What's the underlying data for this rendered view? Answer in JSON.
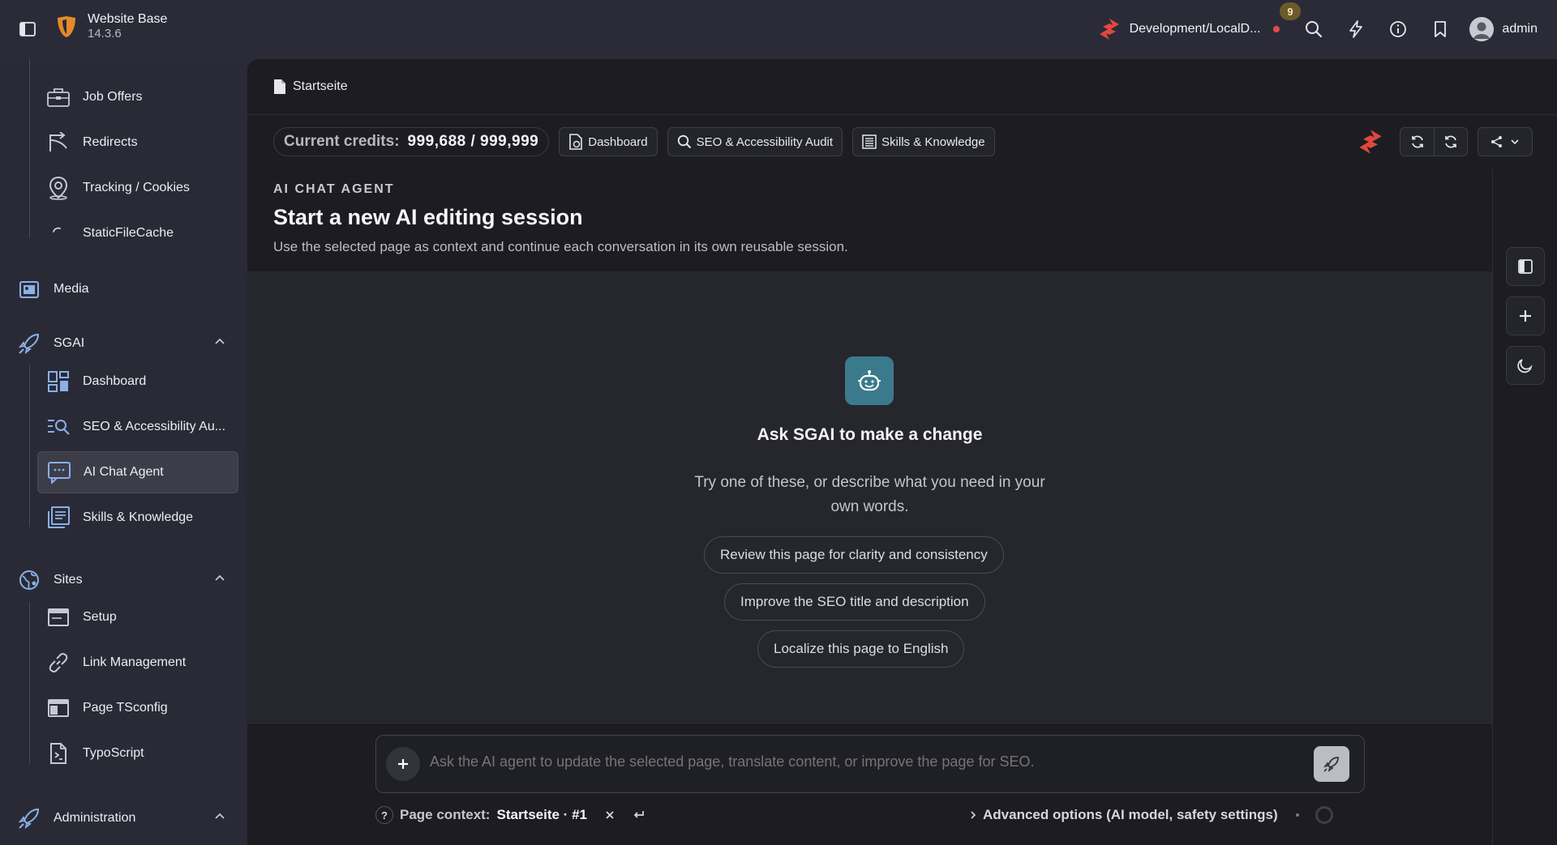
{
  "app": {
    "title": "Website Base",
    "version": "14.3.6"
  },
  "topbar": {
    "environment": "Development/LocalD...",
    "notification_count": "9",
    "username": "admin",
    "icons": [
      "sidebar-toggle-icon",
      "search-icon",
      "bolt-icon",
      "info-icon",
      "bookmark-icon"
    ]
  },
  "sidebar": {
    "top_items": [
      {
        "label": "Job Offers",
        "icon": "briefcase-icon"
      },
      {
        "label": "Redirects",
        "icon": "redirect-icon"
      },
      {
        "label": "Tracking / Cookies",
        "icon": "location-pin-icon"
      },
      {
        "label": "StaticFileCache",
        "icon": "spinner-icon"
      }
    ],
    "media": {
      "label": "Media",
      "icon": "media-icon"
    },
    "sgai": {
      "label": "SGAI",
      "items": [
        {
          "label": "Dashboard",
          "icon": "dashboard-icon"
        },
        {
          "label": "SEO & Accessibility Au...",
          "icon": "seo-search-icon"
        },
        {
          "label": "AI Chat Agent",
          "icon": "chat-icon",
          "active": true
        },
        {
          "label": "Skills & Knowledge",
          "icon": "knowledge-icon"
        }
      ]
    },
    "sites": {
      "label": "Sites",
      "items": [
        {
          "label": "Setup",
          "icon": "setup-icon"
        },
        {
          "label": "Link Management",
          "icon": "link-icon"
        },
        {
          "label": "Page TSconfig",
          "icon": "tsconfig-icon"
        },
        {
          "label": "TypoScript",
          "icon": "typoscript-icon"
        }
      ]
    },
    "administration": {
      "label": "Administration",
      "icon": "rocket-icon"
    }
  },
  "main": {
    "breadcrumb": "Startseite",
    "credits_label": "Current credits:",
    "credits_value": "999,688 / 999,999",
    "toolbar_buttons": {
      "dashboard": "Dashboard",
      "audit": "SEO & Accessibility Audit",
      "skills": "Skills & Knowledge"
    },
    "kicker": "AI CHAT AGENT",
    "title": "Start a new AI editing session",
    "subtitle": "Use the selected page as context and continue each conversation in its own reusable session.",
    "empty_state": {
      "title": "Ask SGAI to make a change",
      "subtitle": "Try one of these, or describe what you need in your own words.",
      "suggestions": [
        "Review this page for clarity and consistency",
        "Improve the SEO title and description",
        "Localize this page to English"
      ]
    },
    "composer": {
      "placeholder": "Ask the AI agent to update the selected page, translate content, or improve the page for SEO."
    },
    "context": {
      "label": "Page context:",
      "value": "Startseite · #1"
    },
    "advanced_label": "Advanced options (AI model, safety settings)"
  },
  "colors": {
    "accent_red": "#e0483e",
    "bot_badge": "#3b7a8c",
    "active_item_bg": "#3d3d4a"
  }
}
